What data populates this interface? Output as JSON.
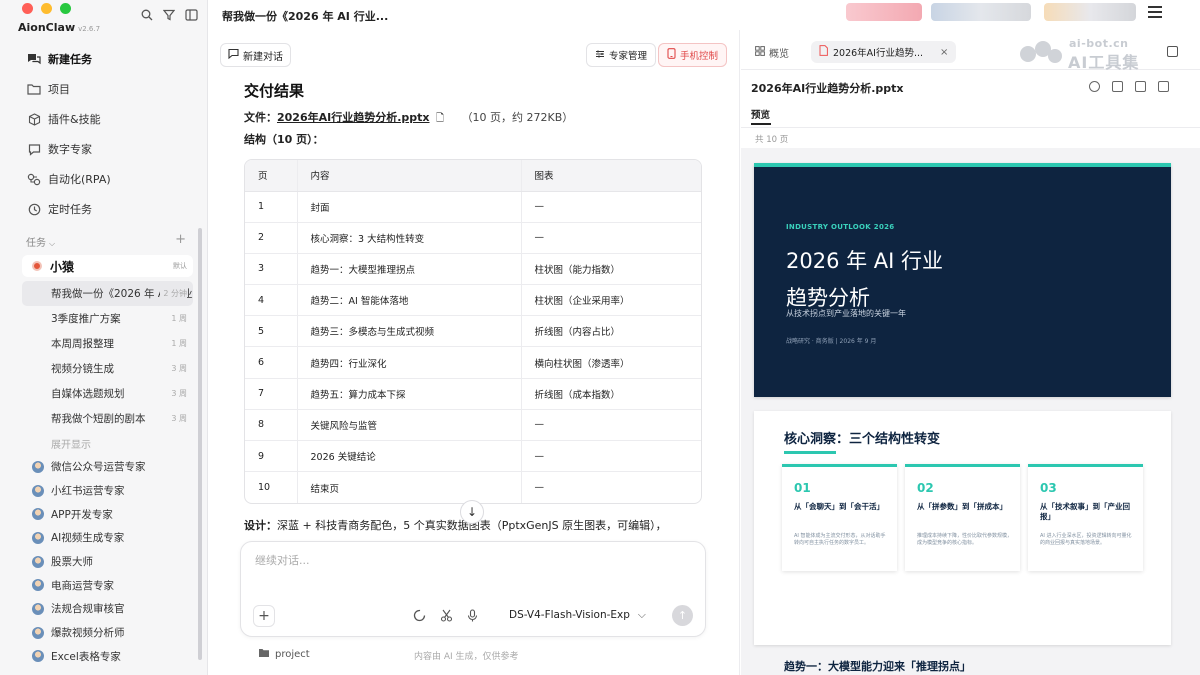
{
  "app": {
    "name": "AionClaw",
    "version": "v2.6.7"
  },
  "header": {
    "title": "帮我做一份《2026 年 AI 行业..."
  },
  "sidebar": {
    "nav": [
      {
        "label": "新建任务",
        "icon": "chat-bubbles-icon"
      },
      {
        "label": "项目",
        "icon": "folder-icon"
      },
      {
        "label": "插件&技能",
        "icon": "cube-icon"
      },
      {
        "label": "数字专家",
        "icon": "chat-icon"
      },
      {
        "label": "自动化(RPA)",
        "icon": "automation-icon"
      },
      {
        "label": "定时任务",
        "icon": "clock-icon"
      }
    ],
    "tasks_header": "任务",
    "group": {
      "name": "小猿",
      "tag": "默认"
    },
    "tasks": [
      {
        "title": "帮我做一份《2026 年 AI 行业趋势分析》",
        "time": "2 分钟"
      },
      {
        "title": "3季度推广方案",
        "time": "1 周"
      },
      {
        "title": "本周周报整理",
        "time": "1 周"
      },
      {
        "title": "视频分镜生成",
        "time": "3 周"
      },
      {
        "title": "自媒体选题规划",
        "time": "3 周"
      },
      {
        "title": "帮我做个短剧的剧本",
        "time": "3 周"
      }
    ],
    "show_more": "展开显示",
    "experts": [
      "微信公众号运营专家",
      "小红书运营专家",
      "APP开发专家",
      "AI视频生成专家",
      "股票大师",
      "电商运营专家",
      "法规合规审核官",
      "爆款视频分析师",
      "Excel表格专家"
    ]
  },
  "chat": {
    "new_chat_label": "新建对话",
    "expert_mgmt_label": "专家管理",
    "phone_control_label": "手机控制",
    "result_heading": "交付结果",
    "file_label": "文件：",
    "file_name": "2026年AI行业趋势分析.pptx",
    "file_meta": "（10 页，约 272KB）",
    "structure_label": "结构（10 页）：",
    "table": {
      "headers": [
        "页",
        "内容",
        "图表"
      ],
      "rows": [
        [
          "1",
          "封面",
          "—"
        ],
        [
          "2",
          "核心洞察：3 大结构性转变",
          "—"
        ],
        [
          "3",
          "趋势一：大模型推理拐点",
          "柱状图（能力指数）"
        ],
        [
          "4",
          "趋势二：AI 智能体落地",
          "柱状图（企业采用率）"
        ],
        [
          "5",
          "趋势三：多模态与生成式视频",
          "折线图（内容占比）"
        ],
        [
          "6",
          "趋势四：行业深化",
          "横向柱状图（渗透率）"
        ],
        [
          "7",
          "趋势五：算力成本下探",
          "折线图（成本指数）"
        ],
        [
          "8",
          "关键风险与监管",
          "—"
        ],
        [
          "9",
          "2026 关键结论",
          "—"
        ],
        [
          "10",
          "结束页",
          "—"
        ]
      ]
    },
    "design_label": "设计：",
    "design_text": "深蓝 + 科技青商务配色，5 个真实数据图表（PptxGenJS 原生图表，可编辑），",
    "composer_placeholder": "继续对话...",
    "model": "DS-V4-Flash-Vision-Exp",
    "project_label": "project",
    "footer_note": "内容由 AI 生成，仅供参考"
  },
  "preview": {
    "tab_overview": "概览",
    "tab_file": "2026年AI行业趋势...",
    "title": "2026年AI行业趋势分析.pptx",
    "subtab": "预览",
    "count": "共 10 页",
    "slide1": {
      "eyebrow": "INDUSTRY OUTLOOK 2026",
      "title_line1": "2026 年 AI 行业",
      "title_line2": "趋势分析",
      "subtitle": "从技术拐点到产业落地的关键一年",
      "footer": "战略研究 · 商务版  |  2026 年 9 月"
    },
    "slide2": {
      "title": "核心洞察：三个结构性转变",
      "cards": [
        {
          "num": "01",
          "title": "从「会聊天」到「会干活」",
          "desc": "AI 智能体成为主流交付形态，从对话助手转向可自主执行任务的数字员工。"
        },
        {
          "num": "02",
          "title": "从「拼参数」到「拼成本」",
          "desc": "推理成本持续下降，性价比取代参数规模，成为模型竞争的核心指标。"
        },
        {
          "num": "03",
          "title": "从「技术叙事」到「产业回报」",
          "desc": "AI 进入行业深水区，投资逻辑转向可量化的商业回报与真实落地场景。"
        }
      ]
    },
    "slide3_peek": "趋势一：大模型能力迎来「推理拐点」"
  },
  "watermark": {
    "line1": "ai-bot.cn",
    "line2": "AI工具集"
  }
}
